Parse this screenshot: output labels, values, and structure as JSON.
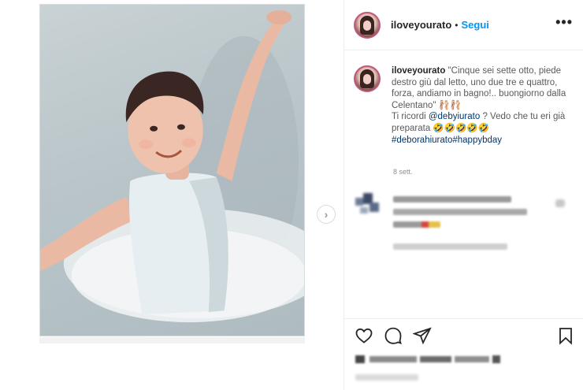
{
  "post": {
    "username": "iloveyourato",
    "separator": "•",
    "follow_label": "Segui",
    "more_label": "•••",
    "caption": {
      "username": "iloveyourato",
      "line1": "\"Cinque sei sette otto, piede destro giù dal letto, uno due tre e quattro, forza, andiamo in bagno!.. buongiorno dalla Celentano\" 🩰🩰",
      "line2_prefix": "Ti ricordi ",
      "mention": "@debyiurato",
      "line2_suffix": " ? Vedo che tu eri già preparata 🤣🤣🤣🤣🤣",
      "hashtags": "#deborahiurato#happybday"
    },
    "timestamp": "8 sett."
  },
  "icons": {
    "like": "heart-icon",
    "comment": "comment-bubble-icon",
    "share": "paper-plane-icon",
    "save": "bookmark-icon",
    "next": "chevron-right-icon"
  },
  "colors": {
    "accent": "#0095f6",
    "link": "#00376b",
    "avatar_ring": "#c3587d"
  }
}
